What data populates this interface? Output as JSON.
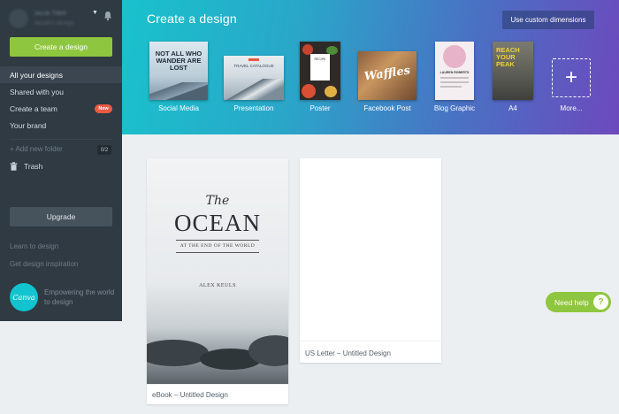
{
  "sidebar": {
    "user_name": "Jacob Tillett",
    "user_sub": "Jacob's design",
    "create_label": "Create a design",
    "nav": [
      {
        "label": "All your designs"
      },
      {
        "label": "Shared with you"
      },
      {
        "label": "Create a team",
        "badge": "New"
      },
      {
        "label": "Your brand"
      }
    ],
    "add_folder": "+ Add new folder",
    "folder_count": "0/2",
    "trash": "Trash",
    "upgrade": "Upgrade",
    "links": [
      "Learn to design",
      "Get design inspiration"
    ],
    "logo_text": "Canva",
    "tagline": "Empowering the world to design"
  },
  "banner": {
    "title": "Create a design",
    "custom_dimensions": "Use custom dimensions",
    "templates": [
      {
        "label": "Social Media",
        "thumb_text": "NOT ALL WHO WANDER ARE LOST"
      },
      {
        "label": "Presentation",
        "thumb_text": "TRAVEL CATALOGUE"
      },
      {
        "label": "Poster",
        "thumb_text": "RECIPE"
      },
      {
        "label": "Facebook Post",
        "thumb_text": "Waffles"
      },
      {
        "label": "Blog Graphic",
        "thumb_text": "LAUREN ROBERTS"
      },
      {
        "label": "A4",
        "thumb_text": "REACH YOUR PEAK"
      },
      {
        "label": "More..."
      }
    ]
  },
  "designs": [
    {
      "label": "eBook – Untitled Design",
      "cover": {
        "the": "The",
        "title": "OCEAN",
        "subtitle": "AT THE END OF THE WORLD",
        "author": "ALEX KEULS"
      }
    },
    {
      "label": "US Letter – Untitled Design"
    }
  ],
  "help": {
    "label": "Need help",
    "icon": "?"
  },
  "colors": {
    "accent_green": "#8fc63f",
    "sidebar_bg": "#2f3a43",
    "badge_red": "#ec5b43"
  }
}
